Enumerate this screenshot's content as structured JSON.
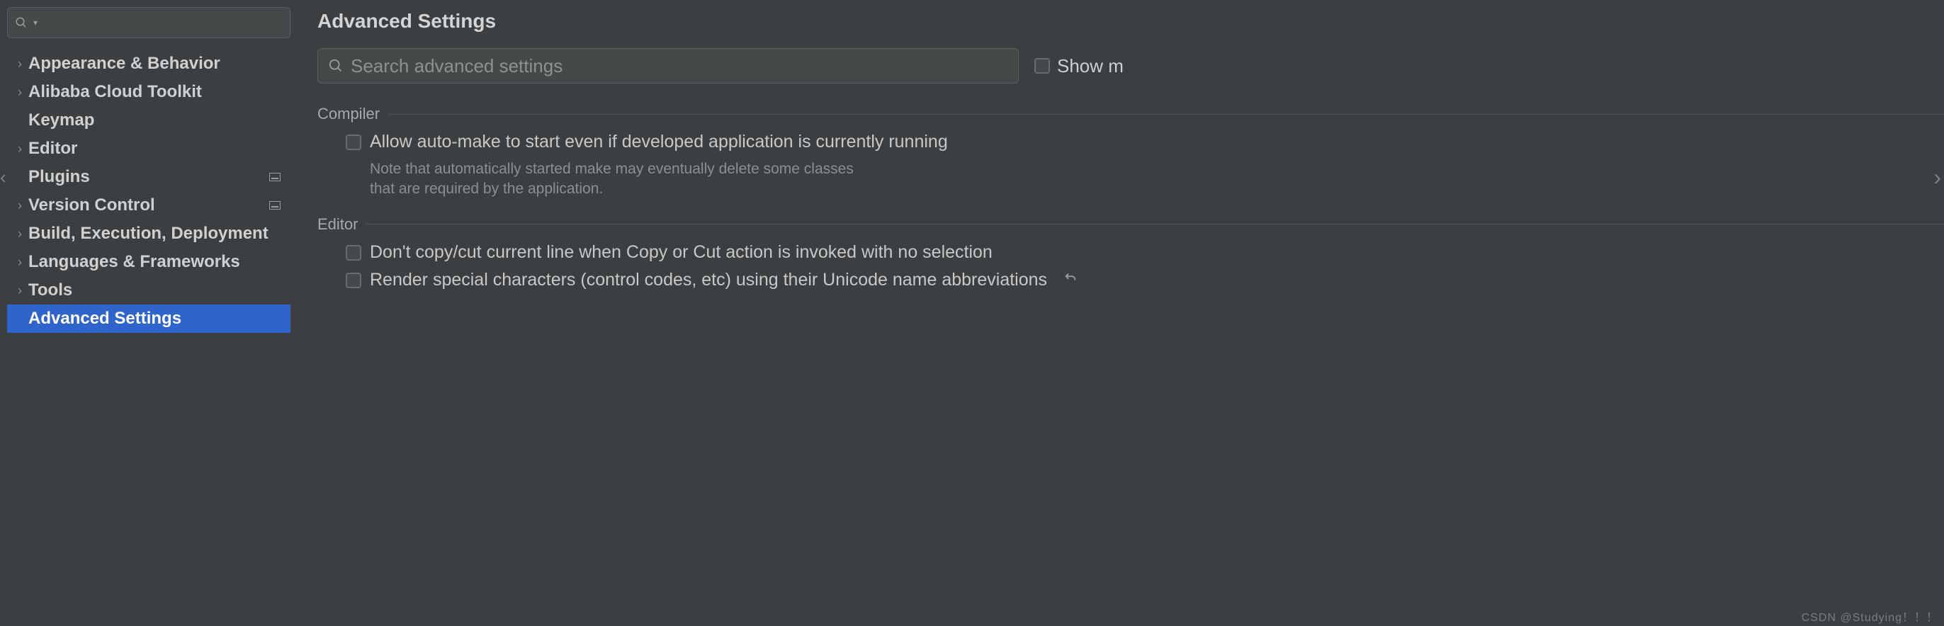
{
  "sidebar": {
    "search_placeholder": "",
    "items": [
      {
        "label": "Appearance & Behavior",
        "chevron": true
      },
      {
        "label": "Alibaba Cloud Toolkit",
        "chevron": true
      },
      {
        "label": "Keymap",
        "chevron": false
      },
      {
        "label": "Editor",
        "chevron": true
      },
      {
        "label": "Plugins",
        "chevron": false,
        "glyph": true,
        "back": true
      },
      {
        "label": "Version Control",
        "chevron": true,
        "glyph": true
      },
      {
        "label": "Build, Execution, Deployment",
        "chevron": true
      },
      {
        "label": "Languages & Frameworks",
        "chevron": true
      },
      {
        "label": "Tools",
        "chevron": true
      },
      {
        "label": "Advanced Settings",
        "chevron": false,
        "active": true
      }
    ]
  },
  "content": {
    "title": "Advanced Settings",
    "search_placeholder": "Search advanced settings",
    "show_more_label": "Show m",
    "groups": {
      "compiler": {
        "title": "Compiler",
        "automake_label": "Allow auto-make to start even if developed application is currently running",
        "automake_note_1": "Note that automatically started make may eventually delete some classes",
        "automake_note_2": "that are required by the application."
      },
      "editor": {
        "title": "Editor",
        "nocopy_label": "Don't copy/cut current line when Copy or Cut action is invoked with no selection",
        "render_label": "Render special characters (control codes, etc) using their Unicode name abbreviations"
      }
    }
  },
  "watermark": "CSDN @Studying！！！"
}
